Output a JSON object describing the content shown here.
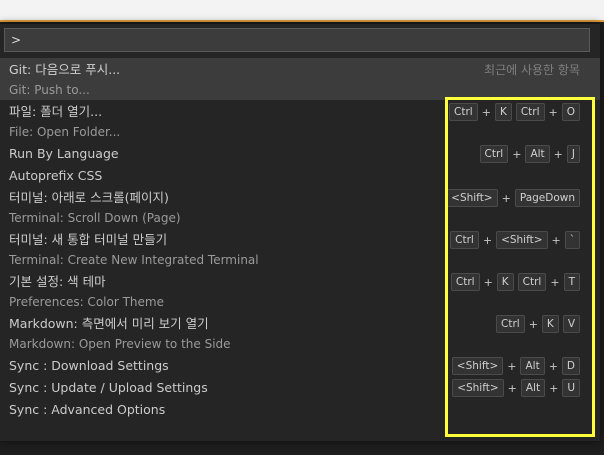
{
  "command_palette": {
    "input_value": ">",
    "recent_label": "최근에 사용한 항목",
    "items": [
      {
        "primary": "Git: 다음으로 푸시...",
        "secondary": "Git: Push to...",
        "keys": [],
        "selected": true
      },
      {
        "primary": "파일: 폴더 열기...",
        "secondary": "File: Open Folder...",
        "keys": [
          "Ctrl",
          "+",
          "K",
          "Ctrl",
          "+",
          "O"
        ]
      },
      {
        "primary": "Run By Language",
        "secondary": "",
        "keys": [
          "Ctrl",
          "+",
          "Alt",
          "+",
          "J"
        ]
      },
      {
        "primary": "Autoprefix CSS",
        "secondary": "",
        "keys": []
      },
      {
        "primary": "터미널: 아래로 스크롤(페이지)",
        "secondary": "Terminal: Scroll Down (Page)",
        "keys": [
          "<Shift>",
          "+",
          "PageDown"
        ]
      },
      {
        "primary": "터미널: 새 통합 터미널 만들기",
        "secondary": "Terminal: Create New Integrated Terminal",
        "keys": [
          "Ctrl",
          "+",
          "<Shift>",
          "+",
          "`"
        ]
      },
      {
        "primary": "기본 설정: 색 테마",
        "secondary": "Preferences: Color Theme",
        "keys": [
          "Ctrl",
          "+",
          "K",
          "Ctrl",
          "+",
          "T"
        ]
      },
      {
        "primary": "Markdown: 측면에서 미리 보기 열기",
        "secondary": "Markdown: Open Preview to the Side",
        "keys": [
          "Ctrl",
          "+",
          "K",
          "V"
        ]
      },
      {
        "primary": "Sync : Download Settings",
        "secondary": "",
        "keys": [
          "<Shift>",
          "+",
          "Alt",
          "+",
          "D"
        ]
      },
      {
        "primary": "Sync : Update / Upload Settings",
        "secondary": "",
        "keys": [
          "<Shift>",
          "+",
          "Alt",
          "+",
          "U"
        ]
      },
      {
        "primary": "Sync : Advanced Options",
        "secondary": "",
        "keys": []
      }
    ]
  },
  "colors": {
    "highlight_box": "#ffff3a",
    "top_strip_accent": "#e7a33e"
  }
}
